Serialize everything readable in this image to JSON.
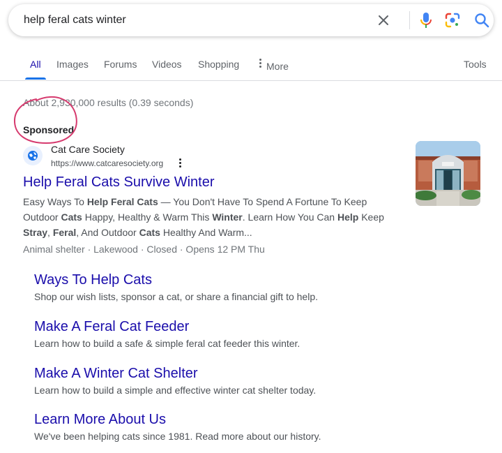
{
  "search": {
    "query": "help feral cats winter"
  },
  "tabs": {
    "all": "All",
    "images": "Images",
    "forums": "Forums",
    "videos": "Videos",
    "shopping": "Shopping",
    "more": "More",
    "tools": "Tools"
  },
  "results": {
    "stats": "About 2,930,000 results (0.39 seconds)",
    "sponsored_label": "Sponsored"
  },
  "ad": {
    "site_name": "Cat Care Society",
    "url": "https://www.catcaresociety.org",
    "title": "Help Feral Cats Survive Winter",
    "description": [
      {
        "t": "Easy Ways To ",
        "b": false
      },
      {
        "t": "Help Feral Cats",
        "b": true
      },
      {
        "t": " — You Don't Have To Spend A Fortune To Keep Outdoor ",
        "b": false
      },
      {
        "t": "Cats",
        "b": true
      },
      {
        "t": " Happy, Healthy & Warm This ",
        "b": false
      },
      {
        "t": "Winter",
        "b": true
      },
      {
        "t": ". Learn How You Can ",
        "b": false
      },
      {
        "t": "Help",
        "b": true
      },
      {
        "t": " Keep ",
        "b": false
      },
      {
        "t": "Stray",
        "b": true
      },
      {
        "t": ", ",
        "b": false
      },
      {
        "t": "Feral",
        "b": true
      },
      {
        "t": ", And Outdoor ",
        "b": false
      },
      {
        "t": "Cats",
        "b": true
      },
      {
        "t": " Healthy And Warm...",
        "b": false
      }
    ],
    "info": "Animal shelter · Lakewood · Closed · Opens 12 PM Thu"
  },
  "sitelinks": [
    {
      "title": "Ways To Help Cats",
      "desc": "Shop our wish lists, sponsor a cat, or share a financial gift to help."
    },
    {
      "title": "Make A Feral Cat Feeder",
      "desc": "Learn how to build a safe & simple feral cat feeder this winter."
    },
    {
      "title": "Make A Winter Cat Shelter",
      "desc": "Learn how to build a simple and effective winter cat shelter today."
    },
    {
      "title": "Learn More About Us",
      "desc": "We've been helping cats since 1981. Read more about our history."
    }
  ],
  "icons": {
    "clear": "close-icon",
    "mic": "microphone-icon",
    "lens": "lens-icon",
    "search": "search-icon",
    "favicon": "globe-icon",
    "more": "more-vertical-icon"
  },
  "colors": {
    "link": "#1a0dab",
    "accent": "#1a73e8",
    "annotation": "#d63a6e"
  }
}
